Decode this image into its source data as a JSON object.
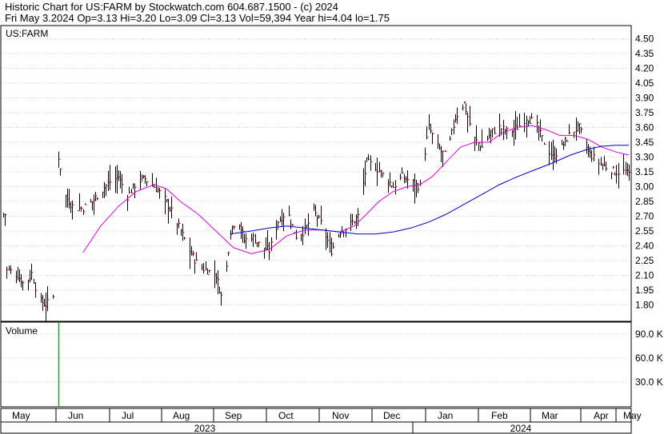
{
  "header": {
    "line1": "Historic Chart for US:FARM by Stockwatch.com 604.687.1500 - (c) 2024",
    "line2": "Fri May  3.2024  Op=3.13  Hi=3.20  Lo=3.09  Cl=3.13  Vol=59,394  Year hi=4.04  lo=1.75"
  },
  "chart_data": {
    "type": "ohlc",
    "symbol": "US:FARM",
    "price_axis": {
      "ticks": [
        1.8,
        1.95,
        2.1,
        2.25,
        2.4,
        2.55,
        2.7,
        2.85,
        3.0,
        3.15,
        3.3,
        3.45,
        3.6,
        3.75,
        3.9,
        4.05,
        4.2,
        4.35,
        4.5
      ],
      "range": [
        1.62,
        4.6
      ]
    },
    "volume_axis": {
      "label": "Volume",
      "ticks": [
        30.0,
        60.0,
        90.0
      ],
      "tick_labels": [
        "30.0 K",
        "60.0 K",
        "90.0 K"
      ],
      "range": [
        0,
        105
      ]
    },
    "months": [
      "May",
      "Jun",
      "Jul",
      "Aug",
      "Sep",
      "Oct",
      "Nov",
      "Dec",
      "Jan",
      "Feb",
      "Mar",
      "Apr",
      "May"
    ],
    "years": [
      "2023",
      "2024"
    ],
    "colors": {
      "bars": "#000000",
      "close_tick": "#cc0000",
      "ma_short": "#dd00dd",
      "ma_long": "#0000cc",
      "volume": "#00bb00",
      "grid": "#cccccc"
    },
    "price_points": [
      {
        "d": 0,
        "c": 2.72
      },
      {
        "d": 3,
        "c": 2.15
      },
      {
        "d": 8,
        "c": 2.1
      },
      {
        "d": 12,
        "c": 2.0
      },
      {
        "d": 16,
        "c": 2.12
      },
      {
        "d": 20,
        "c": 1.85
      },
      {
        "d": 24,
        "c": 1.8
      },
      {
        "d": 28,
        "c": 1.88
      },
      {
        "d": 31,
        "c": 3.3
      },
      {
        "d": 35,
        "c": 2.9
      },
      {
        "d": 40,
        "c": 2.78
      },
      {
        "d": 45,
        "c": 2.78
      },
      {
        "d": 50,
        "c": 2.85
      },
      {
        "d": 55,
        "c": 2.95
      },
      {
        "d": 60,
        "c": 3.05
      },
      {
        "d": 65,
        "c": 3.1
      },
      {
        "d": 70,
        "c": 2.9
      },
      {
        "d": 75,
        "c": 3.05
      },
      {
        "d": 80,
        "c": 3.08
      },
      {
        "d": 85,
        "c": 3.0
      },
      {
        "d": 90,
        "c": 2.9
      },
      {
        "d": 95,
        "c": 2.75
      },
      {
        "d": 100,
        "c": 2.55
      },
      {
        "d": 105,
        "c": 2.35
      },
      {
        "d": 110,
        "c": 2.2
      },
      {
        "d": 115,
        "c": 2.15
      },
      {
        "d": 120,
        "c": 2.1
      },
      {
        "d": 124,
        "c": 1.82
      },
      {
        "d": 128,
        "c": 2.55
      },
      {
        "d": 132,
        "c": 2.7
      },
      {
        "d": 136,
        "c": 2.45
      },
      {
        "d": 140,
        "c": 2.5
      },
      {
        "d": 145,
        "c": 2.4
      },
      {
        "d": 150,
        "c": 2.35
      },
      {
        "d": 155,
        "c": 2.65
      },
      {
        "d": 160,
        "c": 2.75
      },
      {
        "d": 165,
        "c": 2.5
      },
      {
        "d": 170,
        "c": 2.55
      },
      {
        "d": 175,
        "c": 2.75
      },
      {
        "d": 180,
        "c": 2.6
      },
      {
        "d": 185,
        "c": 2.35
      },
      {
        "d": 190,
        "c": 2.55
      },
      {
        "d": 195,
        "c": 2.6
      },
      {
        "d": 200,
        "c": 2.7
      },
      {
        "d": 205,
        "c": 3.25
      },
      {
        "d": 210,
        "c": 3.2
      },
      {
        "d": 215,
        "c": 3.1
      },
      {
        "d": 220,
        "c": 3.0
      },
      {
        "d": 225,
        "c": 3.1
      },
      {
        "d": 230,
        "c": 3.05
      },
      {
        "d": 235,
        "c": 3.0
      },
      {
        "d": 240,
        "c": 3.6
      },
      {
        "d": 245,
        "c": 3.4
      },
      {
        "d": 250,
        "c": 3.3
      },
      {
        "d": 255,
        "c": 3.7
      },
      {
        "d": 260,
        "c": 3.85
      },
      {
        "d": 265,
        "c": 3.5
      },
      {
        "d": 270,
        "c": 3.4
      },
      {
        "d": 275,
        "c": 3.55
      },
      {
        "d": 280,
        "c": 3.6
      },
      {
        "d": 285,
        "c": 3.55
      },
      {
        "d": 290,
        "c": 3.6
      },
      {
        "d": 295,
        "c": 3.7
      },
      {
        "d": 300,
        "c": 3.65
      },
      {
        "d": 305,
        "c": 3.45
      },
      {
        "d": 310,
        "c": 3.3
      },
      {
        "d": 315,
        "c": 3.4
      },
      {
        "d": 320,
        "c": 3.55
      },
      {
        "d": 325,
        "c": 3.6
      },
      {
        "d": 330,
        "c": 3.35
      },
      {
        "d": 335,
        "c": 3.25
      },
      {
        "d": 340,
        "c": 3.2
      },
      {
        "d": 345,
        "c": 3.15
      },
      {
        "d": 350,
        "c": 3.15
      },
      {
        "d": 353,
        "c": 3.13
      }
    ],
    "ma_short": [
      {
        "d": 45,
        "v": 2.33
      },
      {
        "d": 55,
        "v": 2.6
      },
      {
        "d": 65,
        "v": 2.8
      },
      {
        "d": 75,
        "v": 2.95
      },
      {
        "d": 85,
        "v": 3.02
      },
      {
        "d": 92,
        "v": 2.98
      },
      {
        "d": 100,
        "v": 2.85
      },
      {
        "d": 110,
        "v": 2.72
      },
      {
        "d": 120,
        "v": 2.55
      },
      {
        "d": 130,
        "v": 2.38
      },
      {
        "d": 140,
        "v": 2.32
      },
      {
        "d": 150,
        "v": 2.36
      },
      {
        "d": 160,
        "v": 2.5
      },
      {
        "d": 170,
        "v": 2.56
      },
      {
        "d": 180,
        "v": 2.56
      },
      {
        "d": 190,
        "v": 2.54
      },
      {
        "d": 198,
        "v": 2.6
      },
      {
        "d": 205,
        "v": 2.72
      },
      {
        "d": 212,
        "v": 2.85
      },
      {
        "d": 220,
        "v": 2.95
      },
      {
        "d": 228,
        "v": 3.0
      },
      {
        "d": 235,
        "v": 3.02
      },
      {
        "d": 242,
        "v": 3.1
      },
      {
        "d": 250,
        "v": 3.25
      },
      {
        "d": 258,
        "v": 3.4
      },
      {
        "d": 266,
        "v": 3.45
      },
      {
        "d": 274,
        "v": 3.45
      },
      {
        "d": 282,
        "v": 3.55
      },
      {
        "d": 290,
        "v": 3.6
      },
      {
        "d": 298,
        "v": 3.62
      },
      {
        "d": 306,
        "v": 3.58
      },
      {
        "d": 314,
        "v": 3.52
      },
      {
        "d": 322,
        "v": 3.52
      },
      {
        "d": 330,
        "v": 3.48
      },
      {
        "d": 338,
        "v": 3.4
      },
      {
        "d": 346,
        "v": 3.35
      },
      {
        "d": 353,
        "v": 3.32
      }
    ],
    "ma_long": [
      {
        "d": 128,
        "v": 2.52
      },
      {
        "d": 140,
        "v": 2.55
      },
      {
        "d": 150,
        "v": 2.58
      },
      {
        "d": 160,
        "v": 2.6
      },
      {
        "d": 170,
        "v": 2.58
      },
      {
        "d": 180,
        "v": 2.56
      },
      {
        "d": 190,
        "v": 2.54
      },
      {
        "d": 200,
        "v": 2.52
      },
      {
        "d": 210,
        "v": 2.52
      },
      {
        "d": 220,
        "v": 2.54
      },
      {
        "d": 230,
        "v": 2.58
      },
      {
        "d": 240,
        "v": 2.64
      },
      {
        "d": 250,
        "v": 2.72
      },
      {
        "d": 260,
        "v": 2.82
      },
      {
        "d": 270,
        "v": 2.92
      },
      {
        "d": 280,
        "v": 3.02
      },
      {
        "d": 290,
        "v": 3.1
      },
      {
        "d": 300,
        "v": 3.17
      },
      {
        "d": 310,
        "v": 3.24
      },
      {
        "d": 320,
        "v": 3.32
      },
      {
        "d": 330,
        "v": 3.38
      },
      {
        "d": 338,
        "v": 3.41
      },
      {
        "d": 346,
        "v": 3.42
      },
      {
        "d": 353,
        "v": 3.42
      }
    ],
    "volume": [
      {
        "d": 31,
        "v": 105
      }
    ]
  }
}
